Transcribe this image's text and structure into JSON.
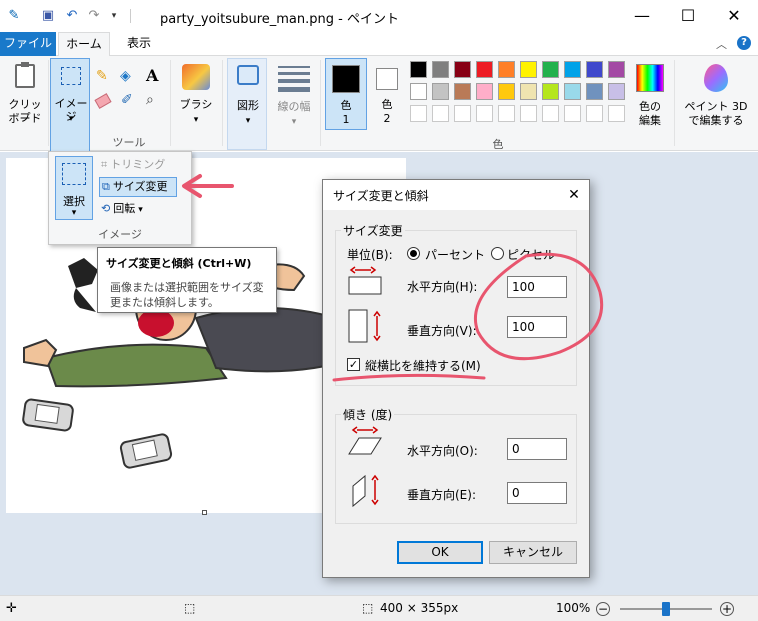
{
  "window": {
    "title": "party_yoitsubure_man.png - ペイント",
    "controls": [
      "—",
      "☐",
      "✕"
    ]
  },
  "menu": {
    "tabs": [
      "ファイル",
      "ホーム",
      "表示"
    ],
    "active_tab": "ホーム"
  },
  "ribbon": {
    "clipboard_label": "クリップボード",
    "clipboard_line1": "クリップ",
    "clipboard_line2": "ボード",
    "image_label": "イメージ",
    "tools_group_label": "ツール",
    "brush_label": "ブラシ",
    "shapes_label": "図形",
    "line_width_label": "線の幅",
    "color1_line1": "色",
    "color1_line2": "1",
    "color2_line1": "色",
    "color2_line2": "2",
    "colors_group_label": "色",
    "edit_colors_line1": "色の",
    "edit_colors_line2": "編集",
    "paint3d_line1": "ペイント 3D",
    "paint3d_line2": "で編集する",
    "palette_row1": [
      "#000000",
      "#7f7f7f",
      "#880015",
      "#ed1c24",
      "#ff7f27",
      "#fff200",
      "#22b14c",
      "#00a2e8",
      "#3f48cc",
      "#a349a4"
    ],
    "palette_row2": [
      "#ffffff",
      "#c3c3c3",
      "#b97a57",
      "#ffaec9",
      "#ffc90e",
      "#efe4b0",
      "#b5e61d",
      "#99d9ea",
      "#7092be",
      "#c8bfe7"
    ],
    "color1": "#000000",
    "color2": "#ffffff"
  },
  "image_dropdown": {
    "select_label": "選択",
    "crop_label": "トリミング",
    "resize_label": "サイズ変更",
    "rotate_label": "回転",
    "group_label": "イメージ"
  },
  "tooltip": {
    "title": "サイズ変更と傾斜 (Ctrl+W)",
    "body_line1": "画像または選択範囲をサイズ変",
    "body_line2": "更または傾斜します。"
  },
  "dialog": {
    "title": "サイズ変更と傾斜",
    "resize_section": "サイズ変更",
    "unit_label": "単位(B):",
    "percent_label": "パーセント",
    "pixel_label": "ピクセル",
    "unit_selected": "パーセント",
    "horizontal_label": "水平方向(H):",
    "horizontal_value": "100",
    "vertical_label": "垂直方向(V):",
    "vertical_value": "100",
    "keep_aspect_label": "縦横比を維持する(M)",
    "keep_aspect_checked": true,
    "skew_section": "傾き (度)",
    "skew_horizontal_label": "水平方向(O):",
    "skew_horizontal_value": "0",
    "skew_vertical_label": "垂直方向(E):",
    "skew_vertical_value": "0",
    "ok_label": "OK",
    "cancel_label": "キャンセル"
  },
  "statusbar": {
    "image_size": "400 × 355px",
    "zoom": "100%",
    "zoom_level": 0.5
  },
  "accent_colors": {
    "file_tab": "#1979ca",
    "annotation": "#e8556e",
    "selected": "#cce4f7"
  }
}
